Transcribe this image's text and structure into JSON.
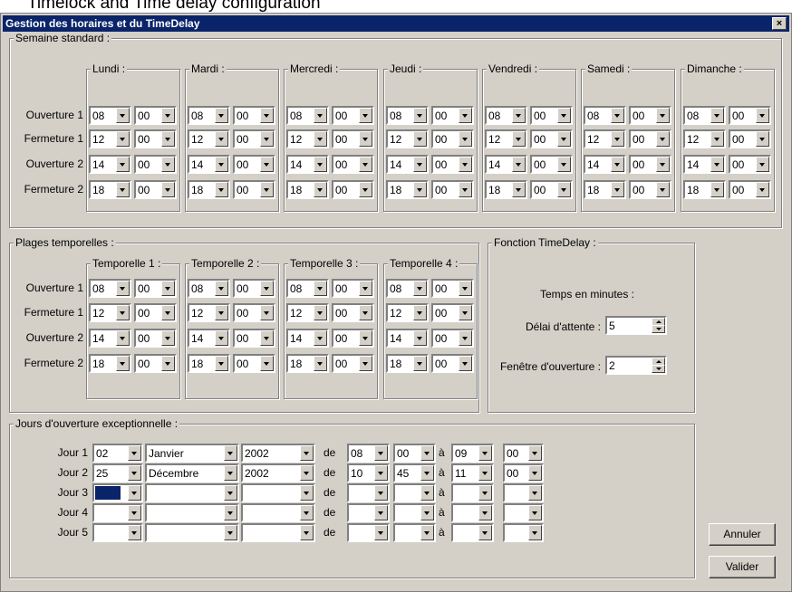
{
  "doc_caption": "Timelock and Time delay configuration",
  "window": {
    "title": "Gestion des horaires et du TimeDelay",
    "close_glyph": "×"
  },
  "row_labels": [
    "Ouverture 1",
    "Fermeture 1",
    "Ouverture 2",
    "Fermeture 2"
  ],
  "semaine": {
    "legend": "Semaine standard :",
    "days": [
      "Lundi :",
      "Mardi :",
      "Mercredi :",
      "Jeudi :",
      "Vendredi :",
      "Samedi :",
      "Dimanche :"
    ],
    "values": [
      [
        "08",
        "00"
      ],
      [
        "12",
        "00"
      ],
      [
        "14",
        "00"
      ],
      [
        "18",
        "00"
      ]
    ]
  },
  "plages": {
    "legend": "Plages temporelles :",
    "columns": [
      "Temporelle 1 :",
      "Temporelle 2 :",
      "Temporelle 3 :",
      "Temporelle 4 :"
    ],
    "values": [
      [
        "08",
        "00"
      ],
      [
        "12",
        "00"
      ],
      [
        "14",
        "00"
      ],
      [
        "18",
        "00"
      ]
    ]
  },
  "timedelay": {
    "legend": "Fonction TimeDelay :",
    "heading": "Temps en minutes :",
    "delai_label": "Délai d'attente :",
    "delai_value": "5",
    "fenetre_label": "Fenêtre d'ouverture :",
    "fenetre_value": "2"
  },
  "jours": {
    "legend": "Jours d'ouverture exceptionnelle :",
    "de": "de",
    "a": "à",
    "rows": [
      {
        "label": "Jour 1",
        "day": "02",
        "month": "Janvier",
        "year": "2002",
        "h1": "08",
        "m1": "00",
        "h2": "09",
        "m2": "00"
      },
      {
        "label": "Jour 2",
        "day": "25",
        "month": "Décembre",
        "year": "2002",
        "h1": "10",
        "m1": "45",
        "h2": "11",
        "m2": "00"
      },
      {
        "label": "Jour 3",
        "day": "",
        "month": "",
        "year": "",
        "h1": "",
        "m1": "",
        "h2": "",
        "m2": ""
      },
      {
        "label": "Jour 4",
        "day": "",
        "month": "",
        "year": "",
        "h1": "",
        "m1": "",
        "h2": "",
        "m2": ""
      },
      {
        "label": "Jour 5",
        "day": "",
        "month": "",
        "year": "",
        "h1": "",
        "m1": "",
        "h2": "",
        "m2": ""
      }
    ]
  },
  "buttons": {
    "annuler": "Annuler",
    "valider": "Valider"
  },
  "icons": {
    "close": "close-icon",
    "dropdown": "chevron-down-icon",
    "spin_up": "arrow-up-icon",
    "spin_down": "arrow-down-icon"
  },
  "colors": {
    "titlebar": "#0a246a",
    "face": "#d4d0c8"
  }
}
